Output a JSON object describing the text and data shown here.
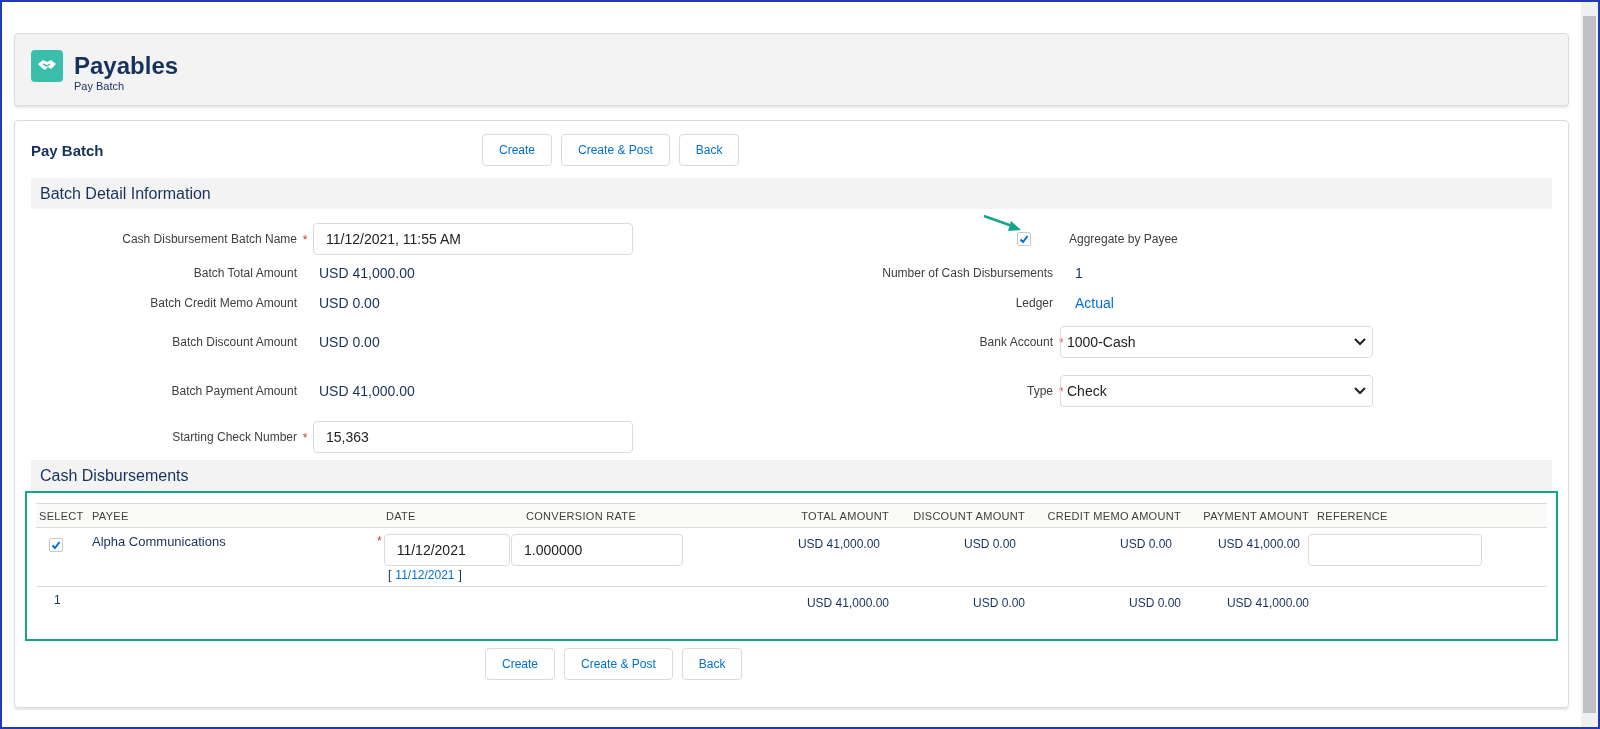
{
  "header": {
    "title": "Payables",
    "subtitle": "Pay Batch"
  },
  "page_title": "Pay Batch",
  "top_buttons": [
    "Create",
    "Create & Post",
    "Back"
  ],
  "batch_section": {
    "title": "Batch Detail Information",
    "left_fields": [
      {
        "kind": "input",
        "label": "Cash Disbursement Batch Name",
        "required_mark": "*",
        "value": "11/12/2021, 11:55 AM"
      },
      {
        "kind": "text",
        "label": "Batch Total Amount",
        "value": "USD 41,000.00"
      },
      {
        "kind": "text",
        "label": "Batch Credit Memo Amount",
        "value": "USD 0.00"
      },
      {
        "kind": "text",
        "label": "Batch Discount Amount",
        "value": "USD 0.00"
      },
      {
        "kind": "text",
        "label": "Batch Payment Amount",
        "value": "USD 41,000.00"
      },
      {
        "kind": "input",
        "label": "Starting Check Number",
        "required_mark": "*",
        "value": "15,363"
      }
    ],
    "right_fields": [
      {
        "kind": "checkbox",
        "label": "Aggregate by Payee",
        "checked": true
      },
      {
        "kind": "text",
        "label": "Number of Cash Disbursements",
        "value": "1"
      },
      {
        "kind": "link",
        "label": "Ledger",
        "value": "Actual"
      },
      {
        "kind": "select",
        "label": "Bank Account",
        "required_mark": "*",
        "value": "1000-Cash"
      },
      {
        "kind": "select",
        "label": "Type",
        "required_mark": "*",
        "value": "Check"
      }
    ]
  },
  "disbursements": {
    "title": "Cash Disbursements",
    "columns": [
      "SELECT",
      "PAYEE",
      "DATE",
      "CONVERSION RATE",
      "TOTAL AMOUNT",
      "DISCOUNT AMOUNT",
      "CREDIT MEMO AMOUNT",
      "PAYMENT AMOUNT",
      "REFERENCE"
    ],
    "rows": [
      {
        "checked": true,
        "payee": "Alpha Communications",
        "date_required_mark": "*",
        "date": "11/12/2021",
        "date_hint_open": "[",
        "date_hint": "11/12/2021",
        "date_hint_close": "]",
        "conversion_rate": "1.000000",
        "total_amount": "USD 41,000.00",
        "discount_amount": "USD 0.00",
        "credit_memo_amount": "USD 0.00",
        "payment_amount": "USD 41,000.00"
      }
    ],
    "totals": {
      "count": "1",
      "total_amount": "USD 41,000.00",
      "discount_amount": "USD 0.00",
      "credit_memo_amount": "USD 0.00",
      "payment_amount": "USD 41,000.00"
    }
  },
  "bottom_buttons": [
    "Create",
    "Create & Post",
    "Back"
  ]
}
